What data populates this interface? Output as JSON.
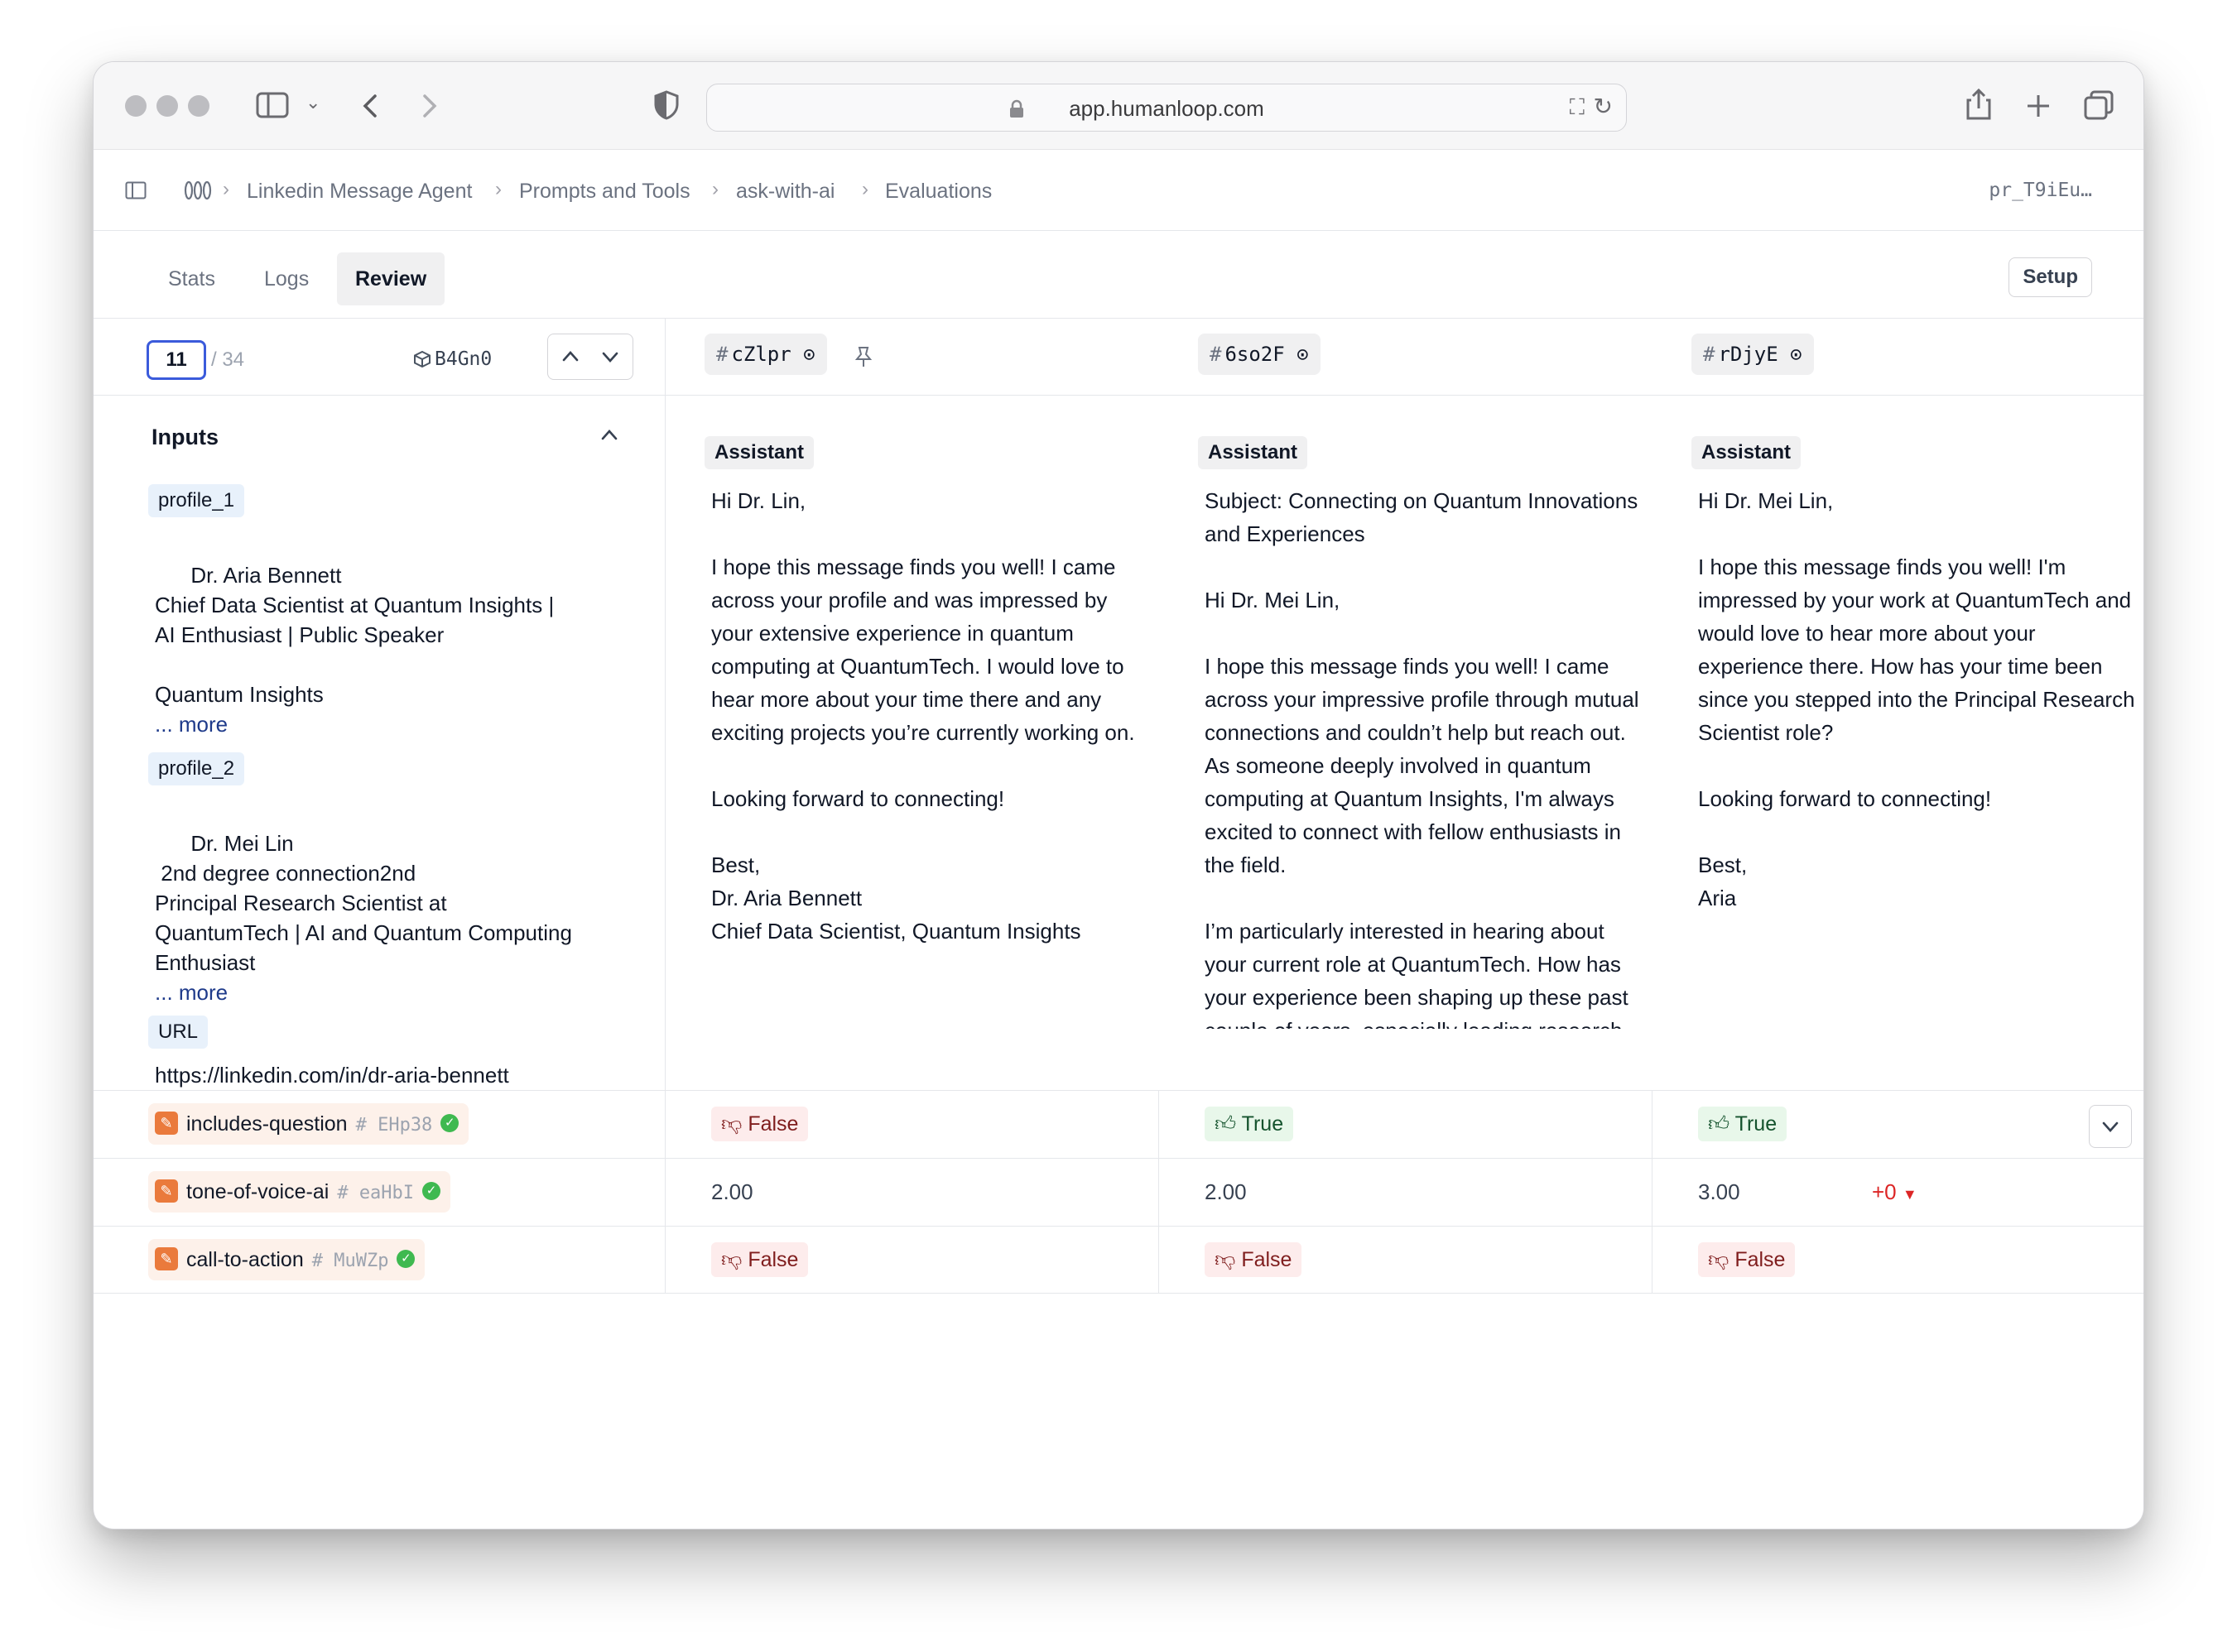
{
  "browser": {
    "url": "app.humanloop.com"
  },
  "breadcrumb": {
    "items": [
      "Linkedin Message Agent",
      "Prompts and Tools",
      "ask-with-ai",
      "Evaluations"
    ],
    "prompt_id": "pr_T9iEu…"
  },
  "tabs": {
    "items": [
      "Stats",
      "Logs",
      "Review"
    ],
    "active": "Review",
    "setup_label": "Setup"
  },
  "navigator": {
    "current": "11",
    "total": "/ 34",
    "dataset_id": "B4Gn0"
  },
  "inputs": {
    "title": "Inputs",
    "profile_1": {
      "label": "profile_1",
      "text": "Dr. Aria Bennett\nChief Data Scientist at Quantum Insights |\nAI Enthusiast | Public Speaker\n\nQuantum Insights\n",
      "more": "... more"
    },
    "profile_2": {
      "label": "profile_2",
      "text": "Dr. Mei Lin\n 2nd degree connection2nd\nPrincipal Research Scientist at\nQuantumTech | AI and Quantum Computing\nEnthusiast\n",
      "more": "... more"
    },
    "url": {
      "label": "URL",
      "text": "https://linkedin.com/in/dr-aria-bennett"
    }
  },
  "logs": [
    {
      "id": "cZlpr",
      "role": "Assistant",
      "message": "Hi Dr. Lin,\n\nI hope this message finds you well! I came across your profile and was impressed by your extensive experience in quantum computing at QuantumTech. I would love to hear more about your time there and any exciting projects you’re currently working on.\n\nLooking forward to connecting!\n\nBest,\nDr. Aria Bennett\nChief Data Scientist, Quantum Insights"
    },
    {
      "id": "6so2F",
      "role": "Assistant",
      "message": "Subject: Connecting on Quantum Innovations and Experiences\n\nHi Dr. Mei Lin,\n\nI hope this message finds you well! I came across your impressive profile through mutual connections and couldn’t help but reach out. As someone deeply involved in quantum computing at Quantum Insights, I'm always excited to connect with fellow enthusiasts in the field.\n\nI’m particularly interested in hearing about your current role at QuantumTech. How has your experience been shaping up these past couple of years, especially leading research initiatives in such a dynamic environment?"
    },
    {
      "id": "rDjyE",
      "role": "Assistant",
      "message": "Hi Dr. Mei Lin,\n\nI hope this message finds you well! I'm impressed by your work at QuantumTech and would love to hear more about your experience there. How has your time been since you stepped into the Principal Research Scientist role?\n\nLooking forward to connecting!\n\nBest,\nAria"
    }
  ],
  "evaluators": [
    {
      "name": "includes-question",
      "id": "EHp38",
      "results": [
        {
          "type": "bool",
          "label": "False"
        },
        {
          "type": "bool",
          "label": "True"
        },
        {
          "type": "bool",
          "label": "True"
        }
      ]
    },
    {
      "name": "tone-of-voice-ai",
      "id": "eaHbI",
      "results": [
        {
          "type": "score",
          "label": "2.00"
        },
        {
          "type": "score",
          "label": "2.00"
        },
        {
          "type": "score",
          "label": "3.00",
          "delta": "+0"
        }
      ]
    },
    {
      "name": "call-to-action",
      "id": "MuWZp",
      "results": [
        {
          "type": "bool",
          "label": "False"
        },
        {
          "type": "bool",
          "label": "False"
        },
        {
          "type": "bool",
          "label": "False"
        }
      ]
    }
  ],
  "colors": {
    "accent": "#3b5bdb",
    "false_bg": "#fdecec",
    "true_bg": "#e8f7ea",
    "evaluator_icon": "#ea7a3c",
    "check_green": "#3fb950",
    "delta_red": "#dc2626"
  },
  "icons": {
    "bool_false": "thumbs-down-icon",
    "bool_true": "thumbs-up-icon",
    "evaluator": "evaluator-icon",
    "verified": "check-circle-icon"
  }
}
